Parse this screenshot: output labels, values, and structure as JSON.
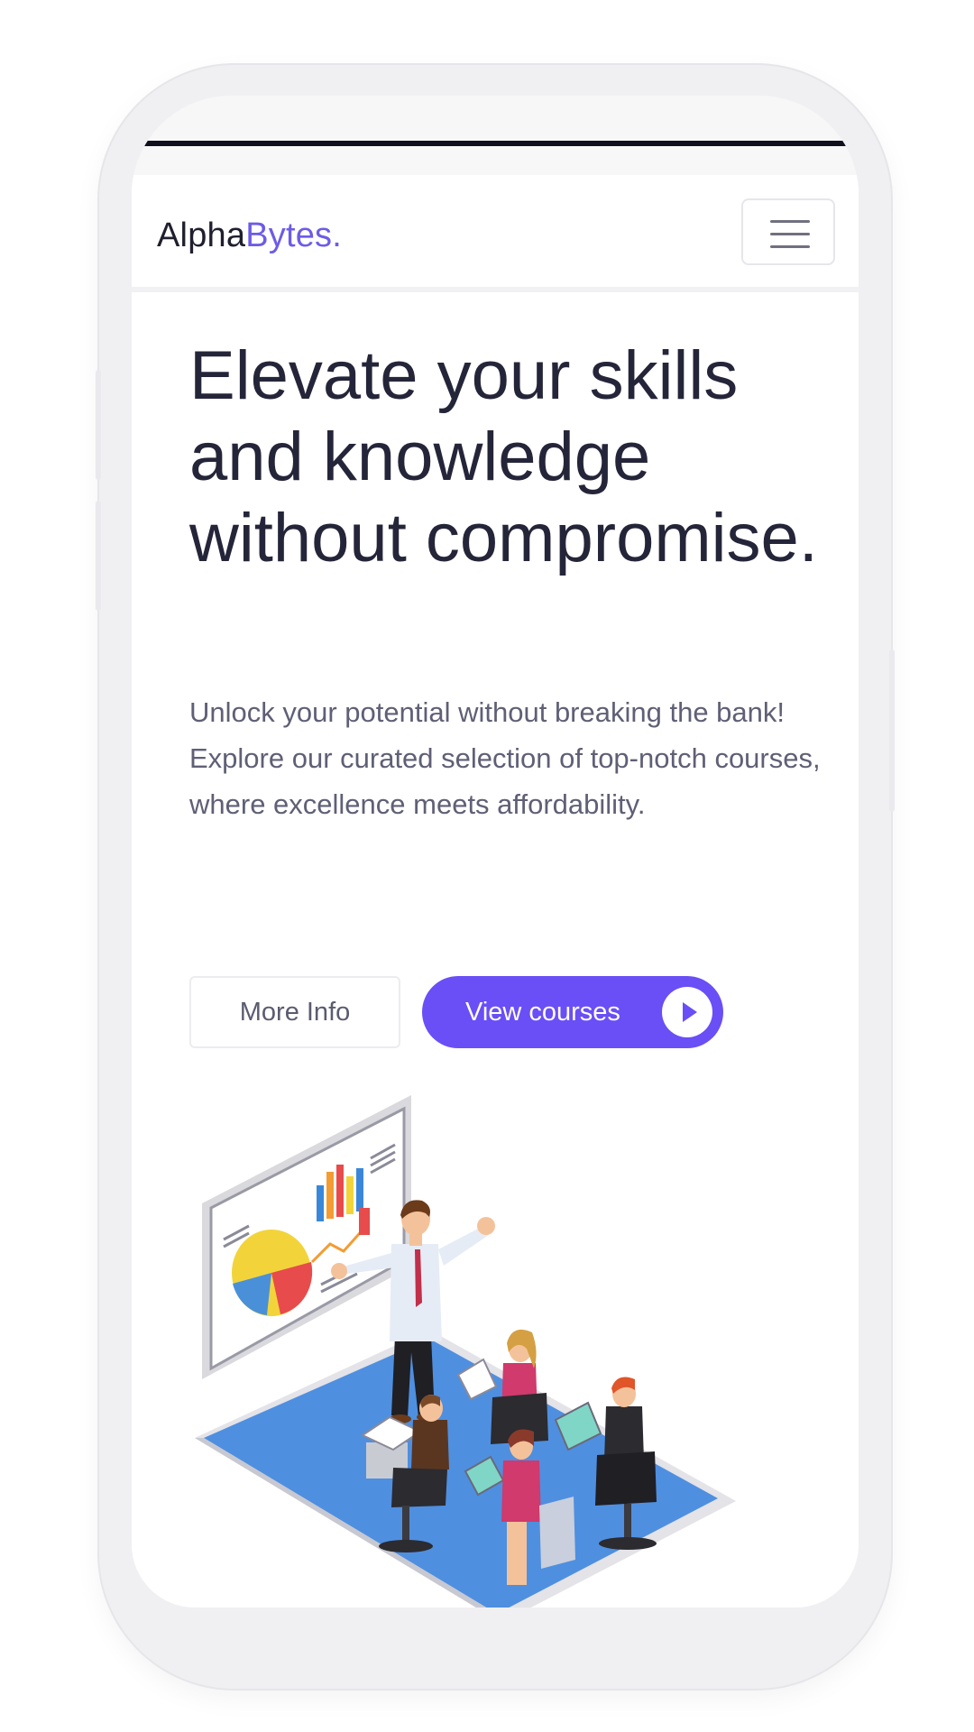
{
  "navbar": {
    "brand_primary": "Alpha",
    "brand_accent": "Bytes.",
    "menu_icon": "hamburger-menu-icon"
  },
  "hero": {
    "title": "Elevate your skills and knowledge without compromise.",
    "description": "Unlock your potential without breaking the bank! Explore our curated selection of top-notch courses, where excellence meets affordability.",
    "more_info_label": "More Info",
    "view_courses_label": "View courses",
    "view_courses_icon": "play-circle-icon"
  },
  "illustration": {
    "icon": "presentation-meeting-illustration"
  },
  "colors": {
    "accent": "#6a4ef6",
    "brand_accent": "#6c5ce7",
    "heading": "#25253a",
    "body_text": "#5f5f76"
  }
}
